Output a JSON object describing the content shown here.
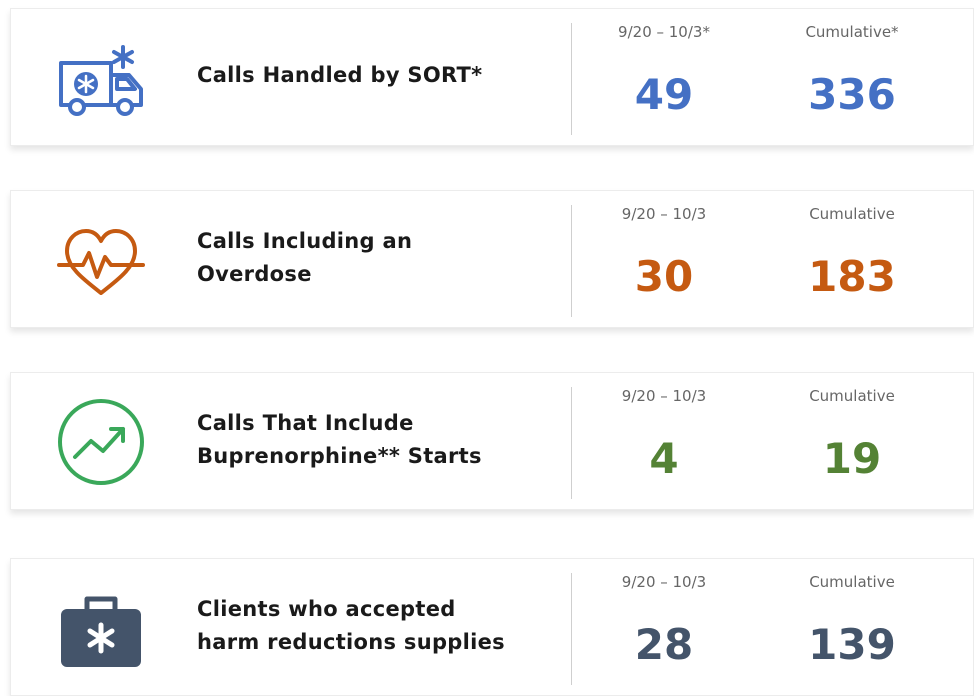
{
  "colors": {
    "blue": "#4470c4",
    "orange": "#c55a11",
    "green": "#548235",
    "green_icon": "#3aa85a",
    "slate": "#44546a"
  },
  "cards": [
    {
      "icon": "ambulance-icon",
      "label": "Calls Handled by SORT*",
      "period_label": "9/20 – 10/3*",
      "cumulative_label": "Cumulative*",
      "period_value": "49",
      "cumulative_value": "336"
    },
    {
      "icon": "heartbeat-icon",
      "label_line1": "Calls Including an",
      "label_line2": "Overdose",
      "period_label": "9/20 – 10/3",
      "cumulative_label": "Cumulative",
      "period_value": "30",
      "cumulative_value": "183"
    },
    {
      "icon": "trend-up-icon",
      "label_line1": "Calls That Include",
      "label_line2": "Buprenorphine** Starts",
      "period_label": "9/20 – 10/3",
      "cumulative_label": "Cumulative",
      "period_value": "4",
      "cumulative_value": "19"
    },
    {
      "icon": "medical-kit-icon",
      "label_line1": "Clients who accepted",
      "label_line2": "harm reductions supplies",
      "period_label": "9/20 – 10/3",
      "cumulative_label": "Cumulative",
      "period_value": "28",
      "cumulative_value": "139"
    }
  ]
}
